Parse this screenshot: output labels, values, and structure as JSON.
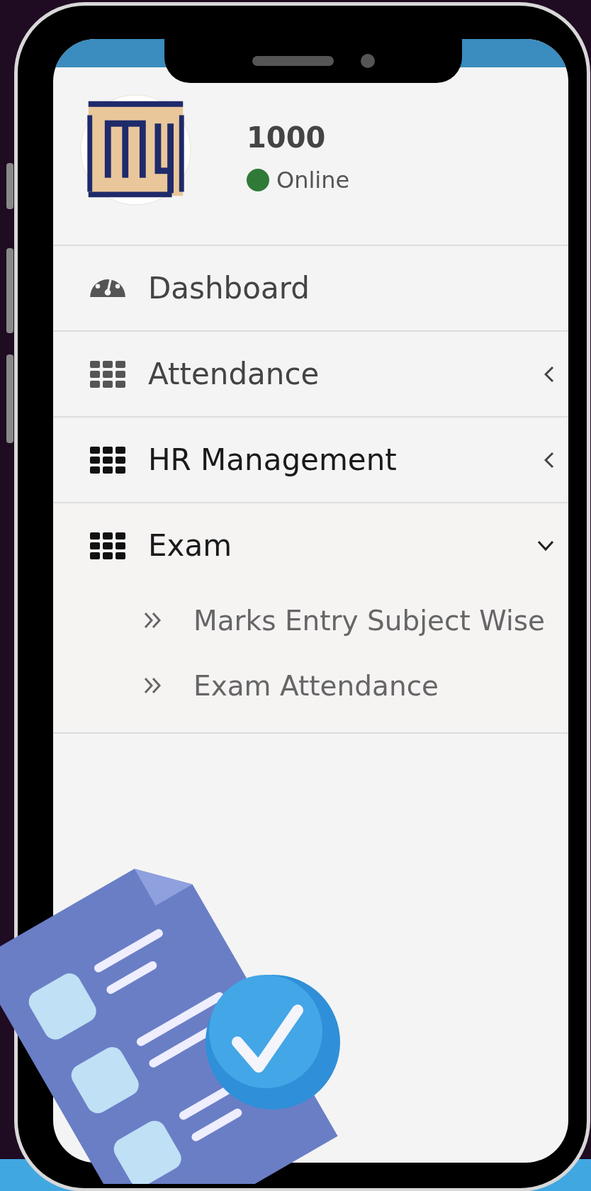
{
  "user": {
    "name": "1000",
    "status": "Online",
    "online": true
  },
  "menu": [
    {
      "label": "Dashboard",
      "kind": "gauge"
    },
    {
      "label": "Attendance",
      "kind": "grid",
      "expanded": false
    },
    {
      "label": "HR Management",
      "kind": "grid",
      "expanded": false
    },
    {
      "label": "Exam",
      "kind": "grid",
      "expanded": true,
      "children": [
        {
          "label": "Marks Entry Subject Wise"
        },
        {
          "label": "Exam Attendance"
        }
      ]
    }
  ]
}
